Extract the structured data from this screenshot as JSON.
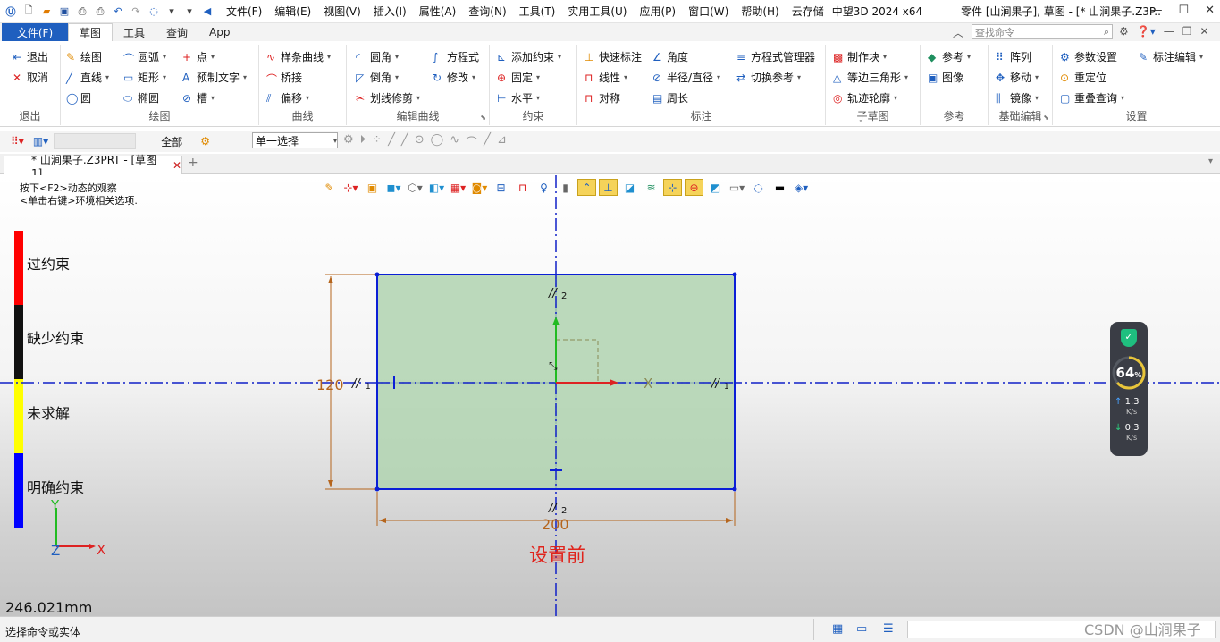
{
  "titlebar": {
    "menus": [
      "文件(F)",
      "编辑(E)",
      "视图(V)",
      "插入(I)",
      "属性(A)",
      "查询(N)",
      "工具(T)",
      "实用工具(U)",
      "应用(P)",
      "窗口(W)",
      "帮助(H)",
      "云存储"
    ],
    "app_name": "中望3D 2024 x64",
    "doc_title": "零件 [山涧果子], 草图 - [* 山涧果子.Z3P..."
  },
  "ribbon_tabs": {
    "file": "文件(F)",
    "tabs": [
      "草图",
      "工具",
      "查询",
      "App"
    ],
    "active": "草图",
    "search_placeholder": "查找命令"
  },
  "ribbon": {
    "exit": {
      "title": "退出",
      "items": [
        "退出",
        "取消"
      ]
    },
    "draw": {
      "title": "绘图",
      "items": [
        "绘图",
        "直线",
        "圆",
        "圆弧",
        "矩形",
        "椭圆",
        "点",
        "预制文字",
        "槽"
      ]
    },
    "curve": {
      "title": "曲线",
      "items": [
        "样条曲线",
        "桥接",
        "偏移"
      ]
    },
    "edit_curve": {
      "title": "编辑曲线",
      "items": [
        "圆角",
        "倒角",
        "划线修剪",
        "方程式",
        "修改"
      ]
    },
    "constraint": {
      "title": "约束",
      "items": [
        "添加约束",
        "固定",
        "水平"
      ]
    },
    "dimension": {
      "title": "标注",
      "items": [
        "快速标注",
        "线性",
        "对称",
        "角度",
        "半径/直径",
        "周长",
        "方程式管理器",
        "切换参考"
      ]
    },
    "subsketch": {
      "title": "子草图",
      "items": [
        "制作块",
        "等边三角形",
        "轨迹轮廓"
      ]
    },
    "reference": {
      "title": "参考",
      "items": [
        "参考",
        "图像"
      ]
    },
    "basic_edit": {
      "title": "基础编辑",
      "items": [
        "阵列",
        "移动",
        "镜像"
      ]
    },
    "settings": {
      "title": "设置",
      "items": [
        "参数设置",
        "重定位",
        "重叠查询",
        "标注编辑"
      ]
    }
  },
  "toolbar2": {
    "filter_all": "全部",
    "select_mode": "单一选择"
  },
  "doc_tab": {
    "label": "* 山涧果子.Z3PRT - [草图1]"
  },
  "canvas": {
    "hint_line1": "按下<F2>动态的观察",
    "hint_line2": "<单击右键>环境相关选项.",
    "legend": [
      {
        "label": "过约束",
        "color": "#ff0000"
      },
      {
        "label": "缺少约束",
        "color": "#111111"
      },
      {
        "label": "未求解",
        "color": "#ffff00"
      },
      {
        "label": "明确约束",
        "color": "#0000ff"
      }
    ],
    "dim_width": "200",
    "dim_height": "120",
    "caption": "设置前",
    "axis_x": "X",
    "axis_y": "Y",
    "axis_z": "Z",
    "sym_label_top": "2",
    "sym_label_bottom": "2",
    "sym_label_left": "1",
    "sym_label_right": "1",
    "origin_axis_x": "X",
    "measure": "246.021mm"
  },
  "widget": {
    "percent": "64",
    "percent_unit": "%",
    "up_value": "1.3",
    "up_unit": "K/s",
    "down_value": "0.3",
    "down_unit": "K/s"
  },
  "status": {
    "text": "选择命令或实体",
    "watermark": "CSDN @山涧果子"
  },
  "colors": {
    "accent": "#1f5fbf",
    "sketch_fill": "#b0d4b0",
    "sketch_edge": "#0b1fd6",
    "dim": "#b5651d",
    "axis": "#1020c8"
  }
}
